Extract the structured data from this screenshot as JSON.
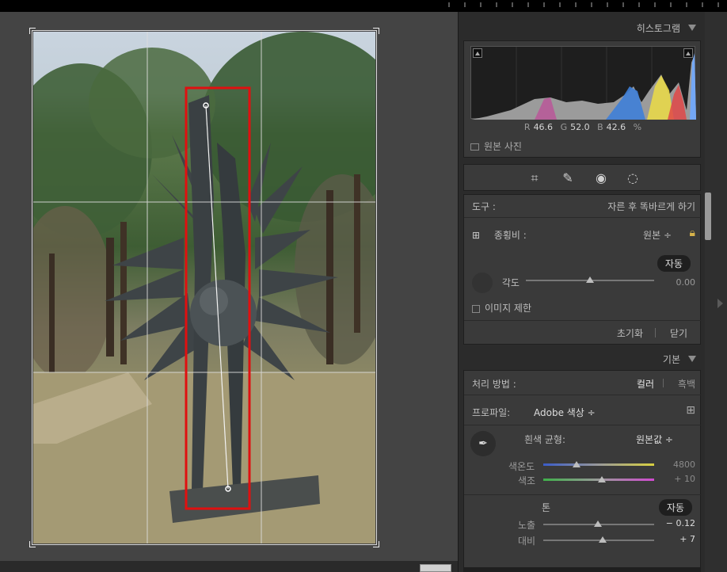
{
  "histogram": {
    "title": "히스토그램",
    "r_label": "R",
    "r_value": "46.6",
    "g_label": "G",
    "g_value": "52.0",
    "b_label": "B",
    "b_value": "42.6",
    "percent": "%",
    "original_photo": "원본 사진"
  },
  "crop": {
    "tool_label": "도구 :",
    "tool_value": "자른 후 똑바르게 하기",
    "aspect_label": "종횡비 :",
    "aspect_value": "원본 ÷",
    "auto_button": "자동",
    "angle_label": "각도",
    "angle_value": "0.00",
    "angle_level": 0.5,
    "constrain_label": "이미지 제한",
    "reset_button": "초기화",
    "close_button": "닫기"
  },
  "basic": {
    "title": "기본",
    "treatment_label": "처리 방법 :",
    "treatment_color": "컬러",
    "treatment_bw": "흑백",
    "profile_label": "프로파일:",
    "profile_value": "Adobe 색상 ÷",
    "wb_label": "흰색 균형:",
    "wb_value": "원본값 ÷",
    "temp_label": "색온도",
    "temp_value": "4800",
    "temp_level": 0.3,
    "tint_label": "색조",
    "tint_value": "+ 10",
    "tint_level": 0.53,
    "tone_label": "톤",
    "tone_auto": "자동",
    "exposure_label": "노출",
    "exposure_value": "− 0.12",
    "exposure_level": 0.49,
    "contrast_label": "대비",
    "contrast_value": "+ 7",
    "contrast_level": 0.535
  },
  "colors": {
    "panel_bg": "#2b2b2b",
    "box_bg": "#3a3a3a",
    "highlight_rect": "#e01010"
  }
}
